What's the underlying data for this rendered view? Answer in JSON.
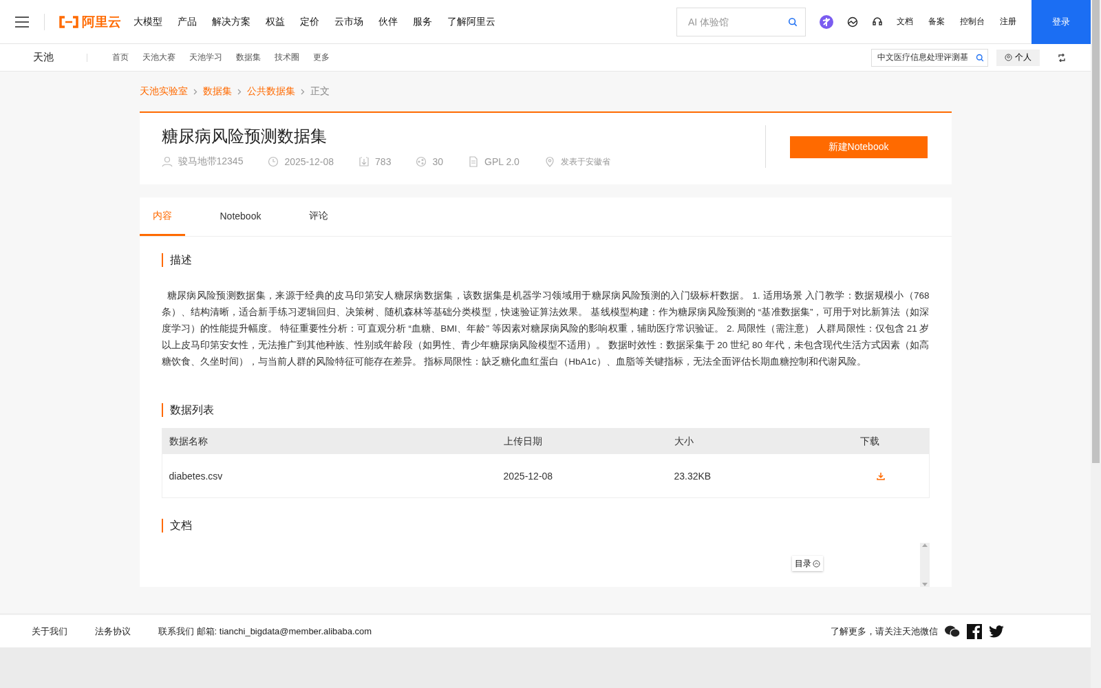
{
  "top_nav": {
    "logo": "阿里云",
    "items": [
      "大模型",
      "产品",
      "解决方案",
      "权益",
      "定价",
      "云市场",
      "伙伴",
      "服务",
      "了解阿里云"
    ],
    "search": {
      "placeholder": "AI 体验馆"
    },
    "links": [
      "文档",
      "备案",
      "控制台",
      "注册"
    ],
    "login": "登录"
  },
  "sub_nav": {
    "brand": "天池",
    "items": [
      "首页",
      "天池大赛",
      "天池学习",
      "数据集",
      "技术圈",
      "更多"
    ],
    "search": {
      "value": "中文医疗信息处理评测基"
    },
    "personal": "个人"
  },
  "breadcrumb": [
    {
      "label": "天池实验室",
      "link": true
    },
    {
      "label": "数据集",
      "link": true
    },
    {
      "label": "公共数据集",
      "link": true
    },
    {
      "label": "正文",
      "link": false
    }
  ],
  "dataset": {
    "title": "糖尿病风险预测数据集",
    "meta": [
      {
        "kind": "user",
        "text": "骏马地带12345"
      },
      {
        "kind": "date",
        "text": "2025-12-08"
      },
      {
        "kind": "download",
        "text": "783"
      },
      {
        "kind": "share",
        "text": "30"
      },
      {
        "kind": "license",
        "text": "GPL 2.0"
      },
      {
        "kind": "location",
        "text": "发表于安徽省"
      }
    ],
    "action": "新建Notebook"
  },
  "tabs": [
    {
      "label": "内容",
      "selected": true
    },
    {
      "label": "Notebook",
      "selected": false
    },
    {
      "label": "评论",
      "selected": false
    }
  ],
  "description": {
    "heading": "描述",
    "text": "糖尿病风险预测数据集，来源于经典的皮马印第安人糖尿病数据集，该数据集是机器学习领域用于糖尿病风险预测的入门级标杆数据。 1. 适用场景 入门教学：数据规模小（768 条）、结构清晰，适合新手练习逻辑回归、决策树、随机森林等基础分类模型，快速验证算法效果。 基线模型构建：作为糖尿病风险预测的 “基准数据集”，可用于对比新算法（如深度学习）的性能提升幅度。 特征重要性分析：可直观分析 “血糖、BMI、年龄” 等因素对糖尿病风险的影响权重，辅助医疗常识验证。 2. 局限性（需注意） 人群局限性：仅包含 21 岁以上皮马印第安女性，无法推广到其他种族、性别或年龄段（如男性、青少年糖尿病风险模型不适用）。 数据时效性：数据采集于 20 世纪 80 年代，未包含现代生活方式因素（如高糖饮食、久坐时间），与当前人群的风险特征可能存在差异。 指标局限性：缺乏糖化血红蛋白（HbA1c）、血脂等关键指标，无法全面评估长期血糖控制和代谢风险。"
  },
  "data_list": {
    "heading": "数据列表",
    "columns": [
      "数据名称",
      "上传日期",
      "大小",
      "下载"
    ],
    "rows": [
      {
        "name": "diabetes.csv",
        "date": "2025-12-08",
        "size": "23.32KB"
      }
    ]
  },
  "docs": {
    "heading": "文档",
    "toc": "目录"
  },
  "footer": {
    "links": [
      "关于我们",
      "法务协议"
    ],
    "contact": "联系我们 邮箱: tianchi_bigdata@member.alibaba.com",
    "follow": "了解更多，请关注天池微信"
  }
}
